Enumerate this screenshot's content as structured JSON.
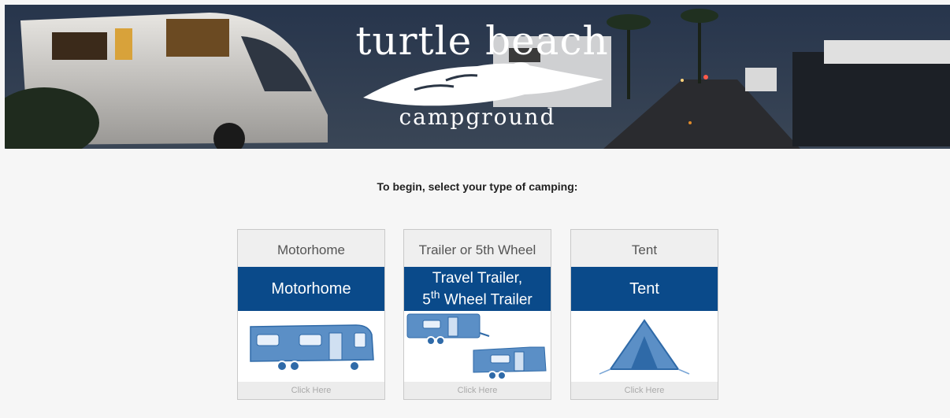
{
  "banner": {
    "logo_title": "turtle beach",
    "logo_subtitle": "campground"
  },
  "prompt": "To begin, select your type of camping:",
  "cards": [
    {
      "heading": "Motorhome",
      "image_line1": "Motorhome",
      "image_line2": "",
      "footer": "Click Here"
    },
    {
      "heading": "Trailer or 5th Wheel",
      "image_line1": "Travel Trailer,",
      "image_line2a": "5",
      "image_line2b": "th",
      "image_line2c": " Wheel Trailer",
      "footer": "Click Here"
    },
    {
      "heading": "Tent",
      "image_line1": "Tent",
      "image_line2": "",
      "footer": "Click Here"
    }
  ],
  "colors": {
    "band": "#0a4a8a",
    "vehicle": "#5b8fc6",
    "page": "#f6f6f6"
  }
}
